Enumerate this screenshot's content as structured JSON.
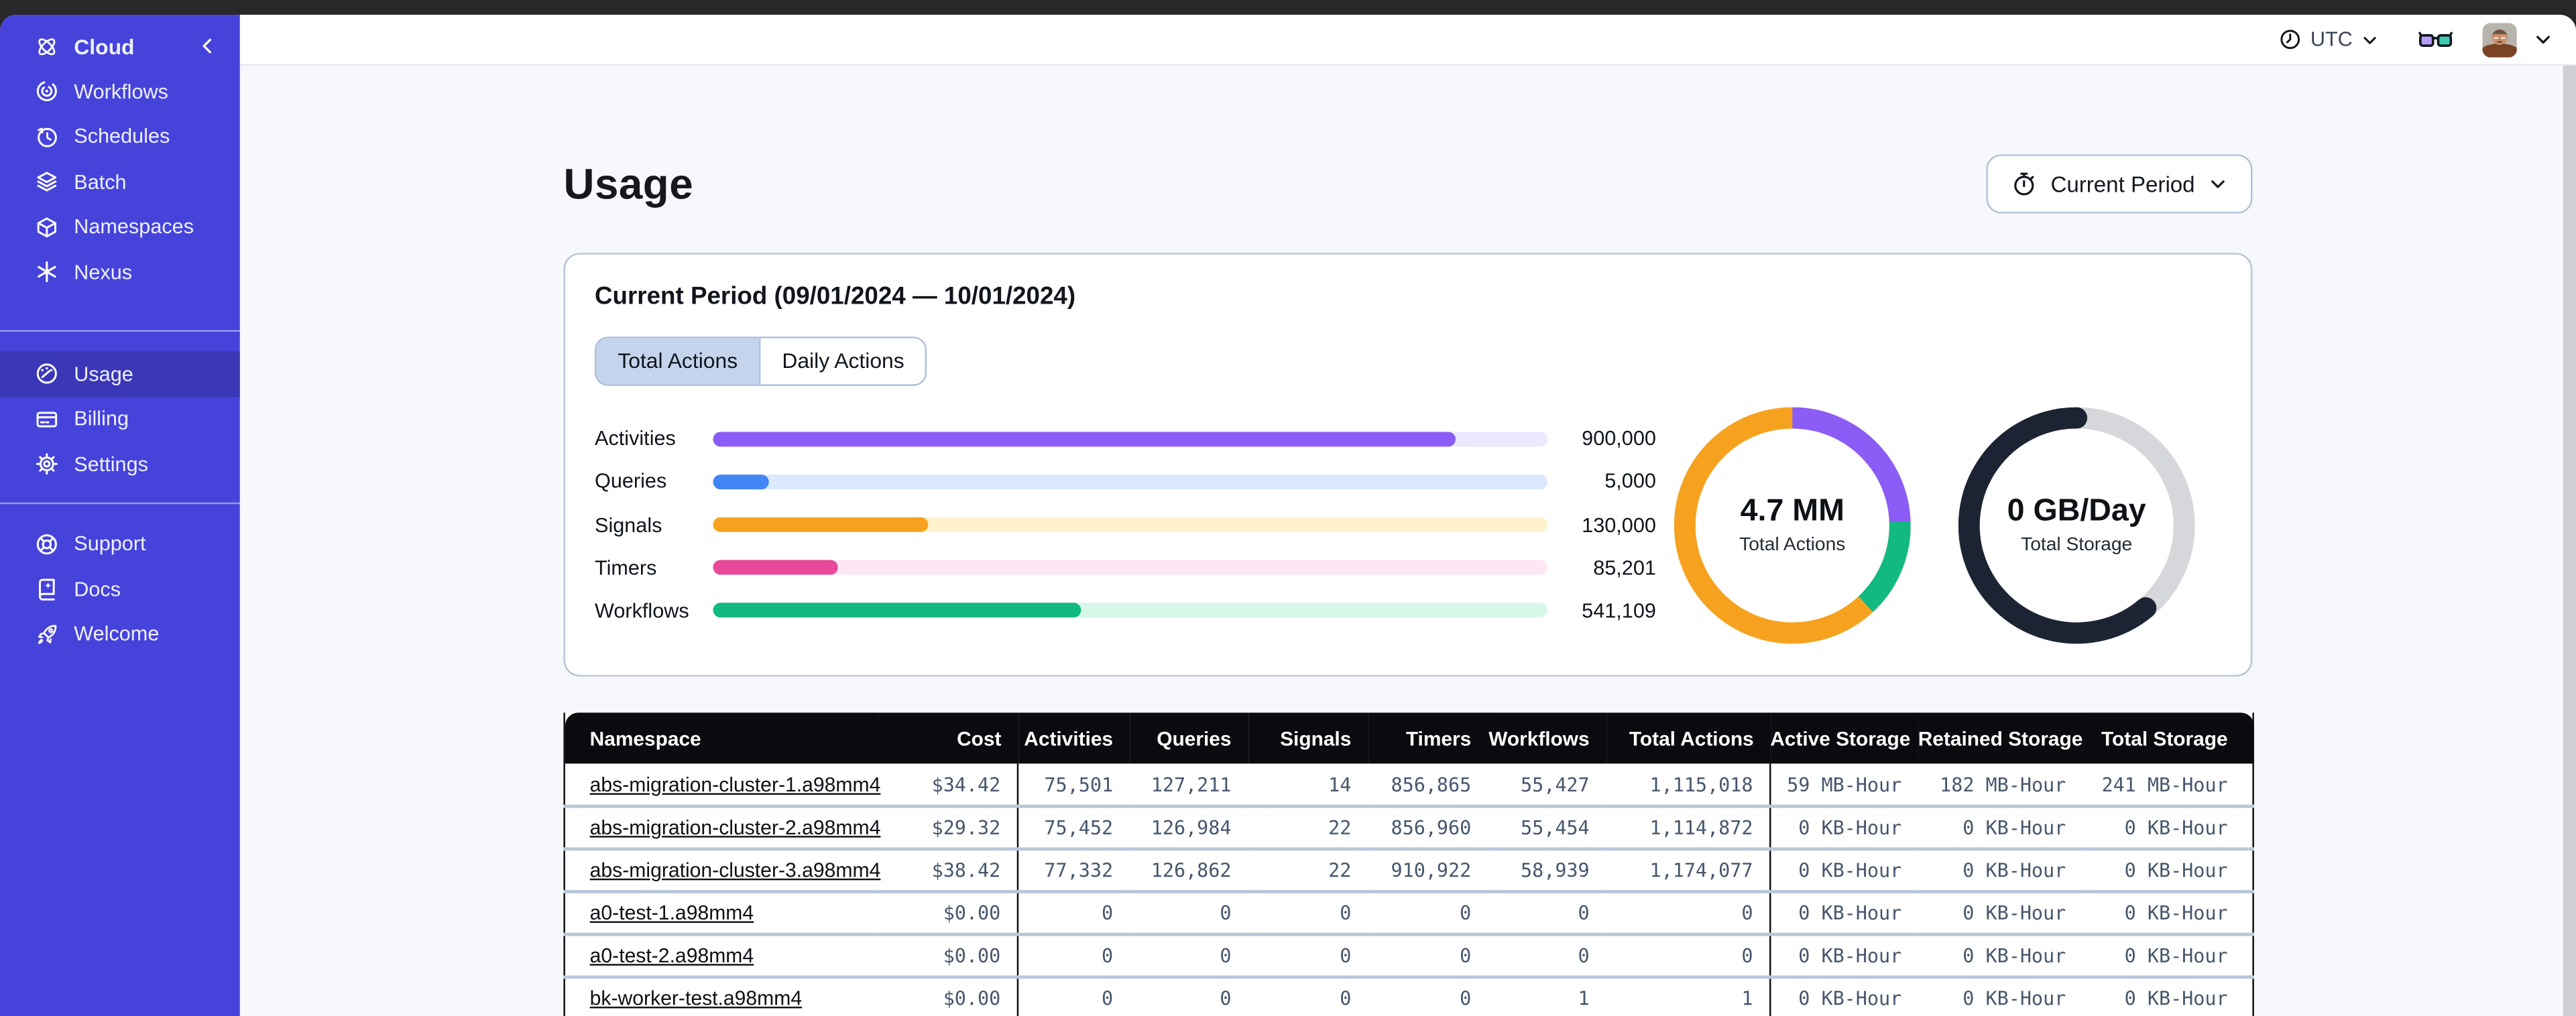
{
  "colors": {
    "sidebar_bg": "#4643DB",
    "sidebar_active_bg": "#3B38B8",
    "table_header_bg": "#0A0B0E",
    "control_border": "#AFBFDB",
    "tab_active_bg": "#C5D4ED"
  },
  "sidebar": {
    "brand": {
      "label": "Cloud"
    },
    "primary": [
      {
        "label": "Workflows"
      },
      {
        "label": "Schedules"
      },
      {
        "label": "Batch"
      },
      {
        "label": "Namespaces"
      },
      {
        "label": "Nexus"
      }
    ],
    "account": [
      {
        "label": "Usage",
        "active": true
      },
      {
        "label": "Billing"
      },
      {
        "label": "Settings"
      }
    ],
    "help": [
      {
        "label": "Support"
      },
      {
        "label": "Docs"
      },
      {
        "label": "Welcome"
      }
    ]
  },
  "topbar": {
    "timezone": "UTC"
  },
  "page": {
    "title": "Usage",
    "period_button_label": "Current Period"
  },
  "card": {
    "title": "Current Period (09/01/2024 — 10/01/2024)",
    "tabs": [
      {
        "label": "Total Actions",
        "active": true
      },
      {
        "label": "Daily Actions",
        "active": false
      }
    ]
  },
  "chart_data": [
    {
      "type": "bar",
      "orientation": "horizontal",
      "title": "Current Period (09/01/2024 — 10/01/2024)",
      "categories": [
        "Activities",
        "Queries",
        "Signals",
        "Timers",
        "Workflows"
      ],
      "values": [
        900000,
        5000,
        130000,
        85201,
        541109
      ],
      "value_labels": [
        "900,000",
        "5,000",
        "130,000",
        "85,201",
        "541,109"
      ],
      "bar_fill_pct": [
        89,
        6.6,
        25.7,
        15,
        44
      ],
      "colors": [
        "#8B5CF6",
        "#4285F4",
        "#F6A21E",
        "#E9499A",
        "#12B981"
      ],
      "track_colors": [
        "#EDE8FD",
        "#DBE9FC",
        "#FDF2CC",
        "#FDE6F5",
        "#D7F8E9"
      ]
    },
    {
      "type": "pie",
      "subtype": "donut",
      "center_value": "4.7 MM",
      "center_label": "Total Actions",
      "segments": [
        {
          "name": "activities",
          "pct": 24.4,
          "color": "#8B5CF6"
        },
        {
          "name": "workflows",
          "pct": 13.6,
          "color": "#12B981"
        },
        {
          "name": "other-actions",
          "pct": 62.0,
          "color": "#F6A21E"
        }
      ]
    },
    {
      "type": "pie",
      "subtype": "donut",
      "center_value": "0 GB/Day",
      "center_label": "Total Storage",
      "segments": [
        {
          "name": "used",
          "pct": 61,
          "color": "#1C2434"
        },
        {
          "name": "remaining",
          "pct": 39,
          "color": "#D6D7DB"
        }
      ]
    }
  ],
  "table": {
    "headers": [
      "Namespace",
      "Cost",
      "Activities",
      "Queries",
      "Signals",
      "Timers",
      "Workflows",
      "Total Actions",
      "Active Storage",
      "Retained Storage",
      "Total Storage"
    ],
    "rows": [
      {
        "namespace": "abs-migration-cluster-1.a98mm4",
        "cost": "$34.42",
        "activities": "75,501",
        "queries": "127,211",
        "signals": "14",
        "timers": "856,865",
        "workflows": "55,427",
        "total_actions": "1,115,018",
        "active_storage": "59 MB-Hour",
        "retained_storage": "182 MB-Hour",
        "total_storage": "241 MB-Hour"
      },
      {
        "namespace": "abs-migration-cluster-2.a98mm4",
        "cost": "$29.32",
        "activities": "75,452",
        "queries": "126,984",
        "signals": "22",
        "timers": "856,960",
        "workflows": "55,454",
        "total_actions": "1,114,872",
        "active_storage": "0 KB-Hour",
        "retained_storage": "0 KB-Hour",
        "total_storage": "0 KB-Hour"
      },
      {
        "namespace": "abs-migration-cluster-3.a98mm4",
        "cost": "$38.42",
        "activities": "77,332",
        "queries": "126,862",
        "signals": "22",
        "timers": "910,922",
        "workflows": "58,939",
        "total_actions": "1,174,077",
        "active_storage": "0 KB-Hour",
        "retained_storage": "0 KB-Hour",
        "total_storage": "0 KB-Hour"
      },
      {
        "namespace": "a0-test-1.a98mm4",
        "cost": "$0.00",
        "activities": "0",
        "queries": "0",
        "signals": "0",
        "timers": "0",
        "workflows": "0",
        "total_actions": "0",
        "active_storage": "0 KB-Hour",
        "retained_storage": "0 KB-Hour",
        "total_storage": "0 KB-Hour"
      },
      {
        "namespace": "a0-test-2.a98mm4",
        "cost": "$0.00",
        "activities": "0",
        "queries": "0",
        "signals": "0",
        "timers": "0",
        "workflows": "0",
        "total_actions": "0",
        "active_storage": "0 KB-Hour",
        "retained_storage": "0 KB-Hour",
        "total_storage": "0 KB-Hour"
      },
      {
        "namespace": "bk-worker-test.a98mm4",
        "cost": "$0.00",
        "activities": "0",
        "queries": "0",
        "signals": "0",
        "timers": "0",
        "workflows": "1",
        "total_actions": "1",
        "active_storage": "0 KB-Hour",
        "retained_storage": "0 KB-Hour",
        "total_storage": "0 KB-Hour"
      }
    ]
  }
}
